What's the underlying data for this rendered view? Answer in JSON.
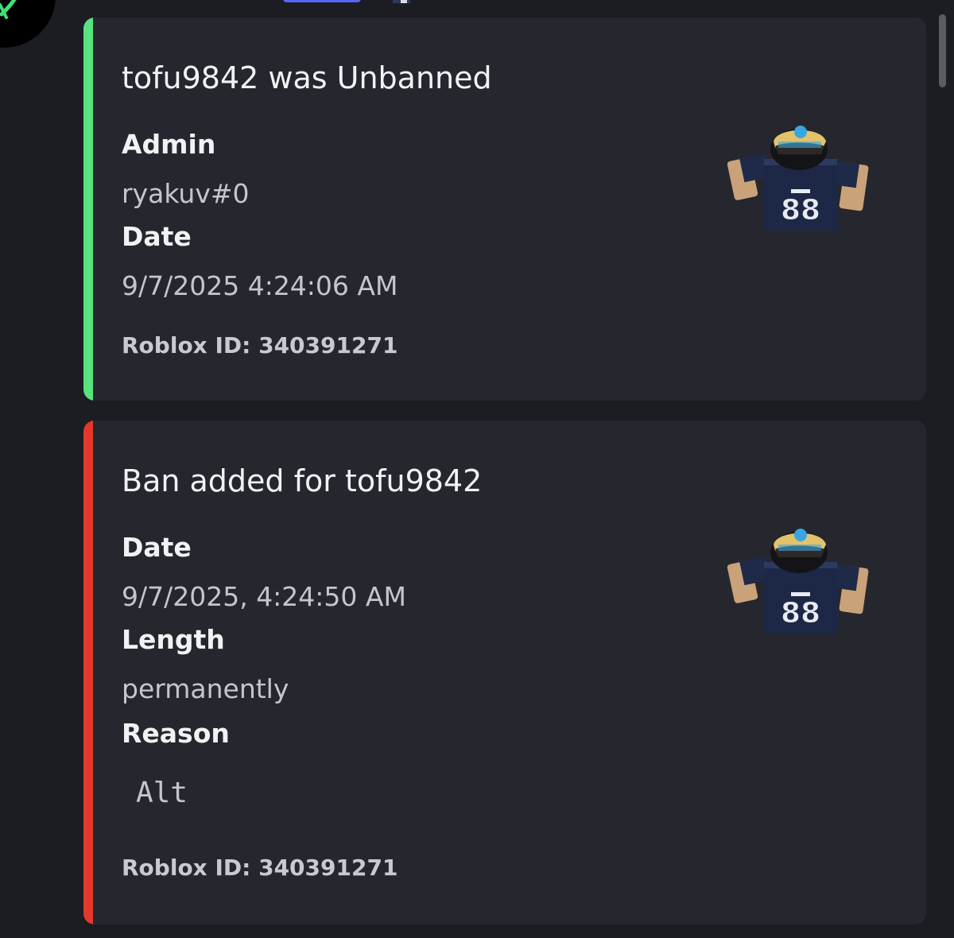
{
  "embeds": [
    {
      "accent_color": "#57e37d",
      "title": "tofu9842 was Unbanned",
      "fields": [
        {
          "name": "Admin",
          "value": "ryakuv#0"
        },
        {
          "name": "Date",
          "value": "9/7/2025 4:24:06 AM"
        }
      ],
      "footer": "Roblox ID: 340391271",
      "thumbnail": "roblox-avatar"
    },
    {
      "accent_color": "#e5382a",
      "title": "Ban added for tofu9842",
      "fields": [
        {
          "name": "Date",
          "value": "9/7/2025, 4:24:50 AM"
        },
        {
          "name": "Length",
          "value": "permanently"
        },
        {
          "name": "Reason",
          "value": "Alt"
        }
      ],
      "footer": "Roblox ID: 340391271",
      "thumbnail": "roblox-avatar"
    }
  ]
}
